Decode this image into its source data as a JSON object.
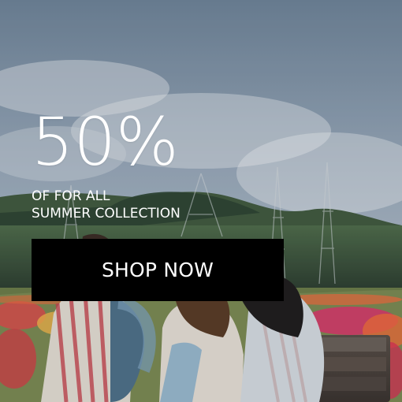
{
  "promo": {
    "headline": "50%",
    "subline_line1": "OF FOR ALL",
    "subline_line2": "SUMMER COLLECTION",
    "button_label": "SHOP NOW"
  },
  "colors": {
    "text": "#ffffff",
    "button_background": "#000000"
  }
}
